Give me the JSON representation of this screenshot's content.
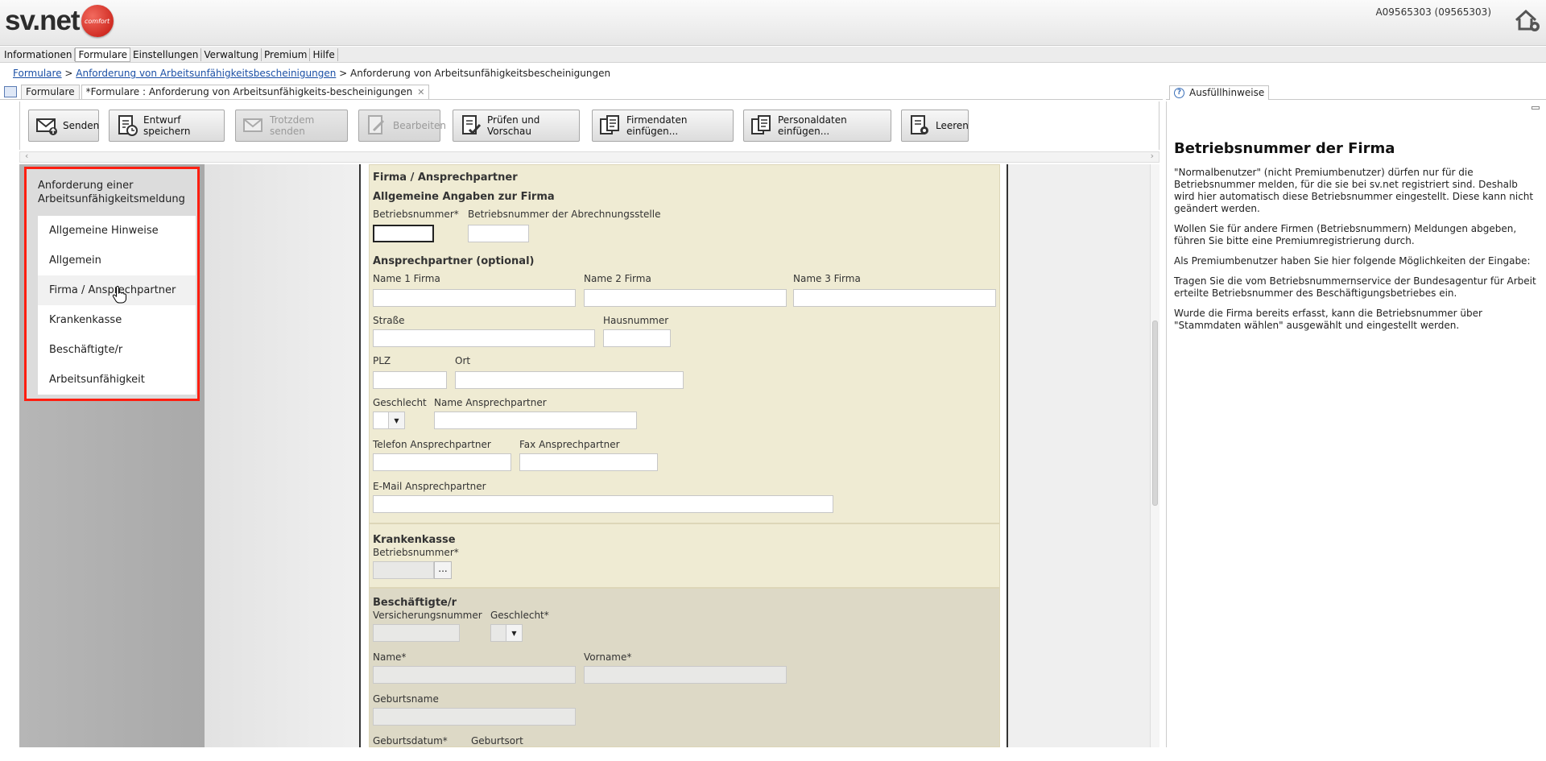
{
  "app": {
    "logo_prefix": "sv",
    "logo_suffix": ".net",
    "logo_badge": "comfort",
    "user_id": "A09565303 (09565303)"
  },
  "menu": [
    "Informationen",
    "Formulare",
    "Einstellungen",
    "Verwaltung",
    "Premium",
    "Hilfe"
  ],
  "menu_active": "Formulare",
  "breadcrumb": {
    "root": "Formulare",
    "sep1": " > ",
    "link": "Anforderung von Arbeitsunfähigkeitsbescheinigungen",
    "sep2": " > ",
    "current": "Anforderung von Arbeitsunfähigkeitsbescheinigungen"
  },
  "tabs": [
    {
      "label": "Formulare"
    },
    {
      "label": "*Formulare : Anforderung von Arbeitsunfähigkeits-bescheinigungen"
    }
  ],
  "toolbar": {
    "send": "Senden",
    "save_draft": "Entwurf speichern",
    "send_anyway": "Trotzdem senden",
    "edit": "Bearbeiten",
    "check_preview": "Prüfen und Vorschau",
    "insert_company": "Firmendaten einfügen...",
    "insert_personnel": "Personaldaten einfügen...",
    "clear": "Leeren"
  },
  "nav": {
    "header": "Anforderung einer Arbeitsunfähigkeitsmeldung",
    "items": [
      "Allgemeine Hinweise",
      "Allgemein",
      "Firma / Ansprechpartner",
      "Krankenkasse",
      "Beschäftigte/r",
      "Arbeitsunfähigkeit"
    ]
  },
  "form": {
    "firma": {
      "title": "Firma / Ansprechpartner",
      "sub_general": "Allgemeine Angaben zur Firma",
      "betriebsnummer": "Betriebsnummer*",
      "betriebsnummer_abrechnung": "Betriebsnummer der Abrechnungsstelle",
      "sub_contact": "Ansprechpartner (optional)",
      "name1": "Name 1 Firma",
      "name2": "Name 2 Firma",
      "name3": "Name 3 Firma",
      "strasse": "Straße",
      "hausnummer": "Hausnummer",
      "plz": "PLZ",
      "ort": "Ort",
      "geschlecht": "Geschlecht",
      "name_ansprechpartner": "Name Ansprechpartner",
      "telefon": "Telefon Ansprechpartner",
      "fax": "Fax Ansprechpartner",
      "email": "E-Mail Ansprechpartner"
    },
    "krankenkasse": {
      "title": "Krankenkasse",
      "betriebsnummer": "Betriebsnummer*",
      "dots": "..."
    },
    "beschaeftigte": {
      "title": "Beschäftigte/r",
      "versicherungsnummer": "Versicherungsnummer",
      "geschlecht": "Geschlecht*",
      "name": "Name*",
      "vorname": "Vorname*",
      "geburtsname": "Geburtsname",
      "geburtsdatum": "Geburtsdatum*",
      "geburtsort": "Geburtsort"
    }
  },
  "right_panel": {
    "tab": "Ausfüllhinweise",
    "title": "Betriebsnummer der Firma",
    "paragraphs": [
      "\"Normalbenutzer\" (nicht Premiumbenutzer) dürfen nur für die Betriebsnummer melden, für die sie bei sv.net registriert sind. Deshalb wird hier automatisch diese Betriebsnummer eingestellt. Diese kann nicht geändert werden.",
      "Wollen Sie für andere Firmen (Betriebsnummern) Meldungen abgeben, führen Sie bitte eine Premiumregistrierung durch.",
      "Als Premiumbenutzer haben Sie hier folgende Möglichkeiten der Eingabe:",
      "Tragen Sie die vom Betriebsnummernservice der Bundesagentur für Arbeit erteilte Betriebsnummer des Beschäftigungsbetriebes ein.",
      "Wurde die Firma bereits erfasst, kann die Betriebsnummer über \"Stammdaten wählen\" ausgewählt und eingestellt werden."
    ]
  },
  "colors": {
    "accent": "#ff1e10",
    "link": "#1a4fa5",
    "section_bg": "#efebd3"
  }
}
